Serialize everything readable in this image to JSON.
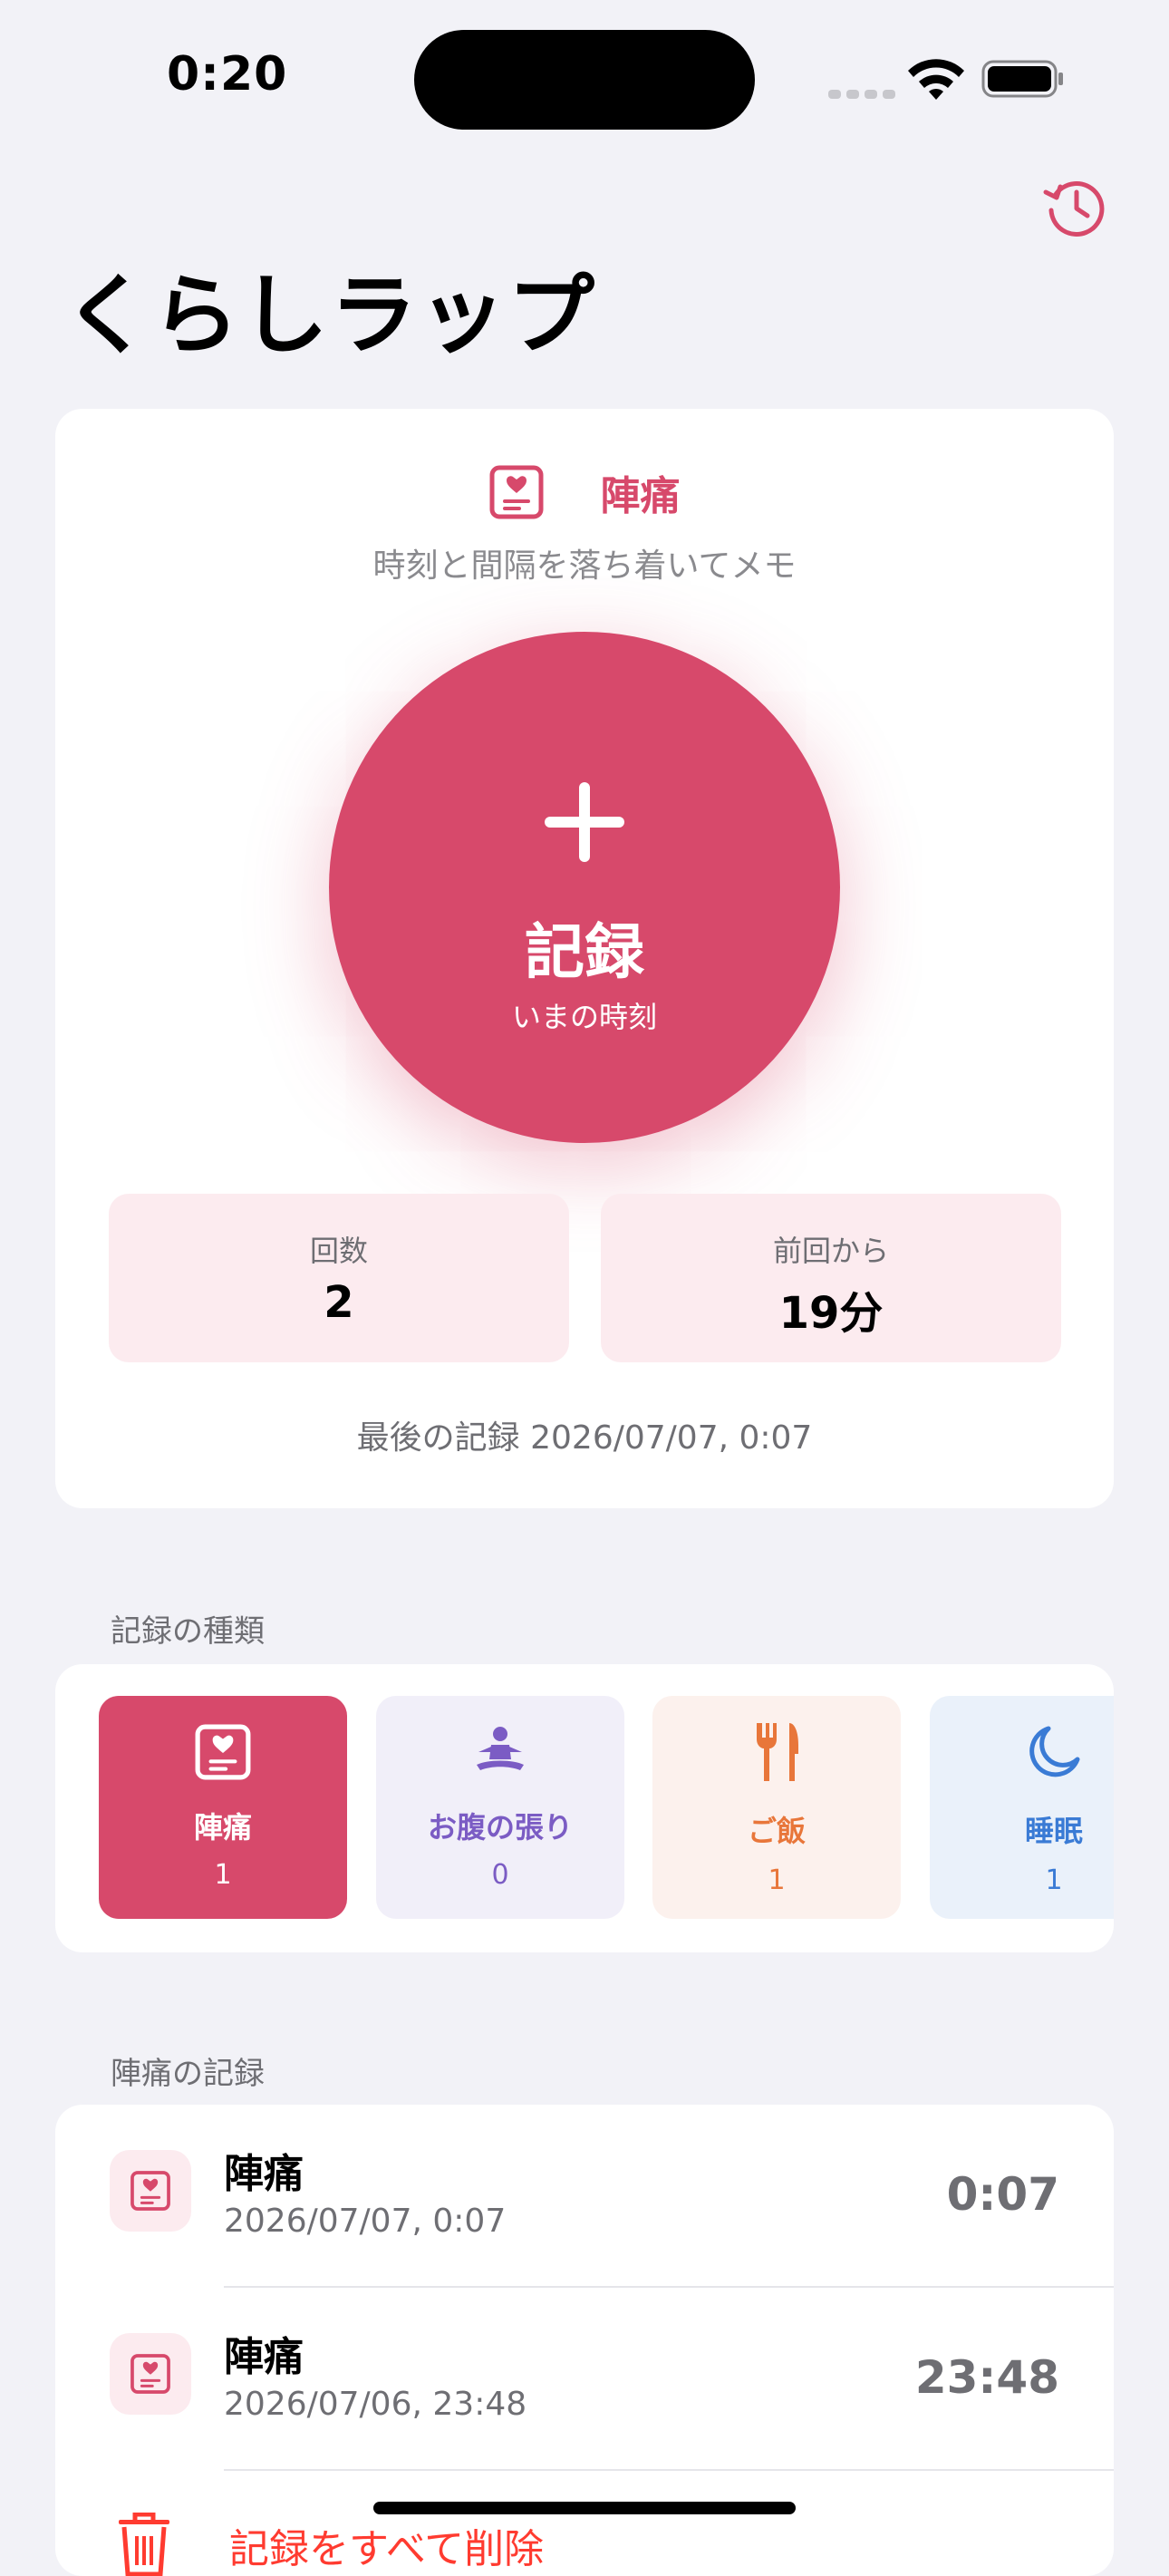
{
  "status_bar": {
    "time": "0:20"
  },
  "app": {
    "title": "くらしラップ"
  },
  "current_category": {
    "name": "陣痛",
    "subtitle": "時刻と間隔を落ち着いてメモ",
    "accent_color": "#D7496B",
    "icon": "heart-note-icon"
  },
  "record_button": {
    "label": "記録",
    "sublabel": "いまの時刻",
    "icon": "plus-icon"
  },
  "stats": [
    {
      "label": "回数",
      "value": "2"
    },
    {
      "label": "前回から",
      "value": "19分"
    }
  ],
  "last_record": "最後の記録 2026/07/07, 0:07",
  "kinds_section": {
    "label": "記録の種類",
    "items": [
      {
        "name": "陣痛",
        "count": "1",
        "icon": "heart-note-icon",
        "color": "#D7496B",
        "selected": true
      },
      {
        "name": "お腹の張り",
        "count": "0",
        "icon": "meditation-icon",
        "color": "#7B5CC4",
        "selected": false
      },
      {
        "name": "ご飯",
        "count": "1",
        "icon": "fork-knife-icon",
        "color": "#E8763A",
        "selected": false
      },
      {
        "name": "睡眠",
        "count": "1",
        "icon": "moon-icon",
        "color": "#3A7BD5",
        "selected": false
      }
    ]
  },
  "records_section": {
    "label": "陣痛の記録",
    "items": [
      {
        "title": "陣痛",
        "date": "2026/07/07, 0:07",
        "time": "0:07"
      },
      {
        "title": "陣痛",
        "date": "2026/07/06, 23:48",
        "time": "23:48"
      }
    ],
    "delete_all_label": "記録をすべて削除"
  }
}
